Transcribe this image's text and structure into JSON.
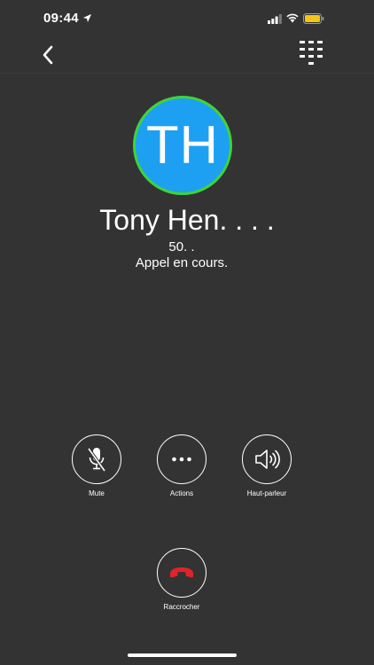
{
  "status_bar": {
    "time": "09:44",
    "icons": [
      "location-arrow-icon",
      "cellular-signal-icon",
      "wifi-icon",
      "battery-icon"
    ],
    "battery_color": "#f5c518"
  },
  "nav": {
    "icons": [
      "chevron-left-icon",
      "dialpad-icon"
    ]
  },
  "contact": {
    "initials": "TH",
    "name": "Tony Hen. . . .",
    "number": "50. .",
    "status": "Appel en cours.",
    "avatar_color": "#1ea0f2",
    "avatar_border_color": "#3fd43a"
  },
  "actions": {
    "mute_label": "Mute",
    "actions_label": "Actions",
    "speaker_label": "Haut-parleur",
    "hangup_label": "Raccrocher",
    "hangup_color": "#e0242a"
  }
}
